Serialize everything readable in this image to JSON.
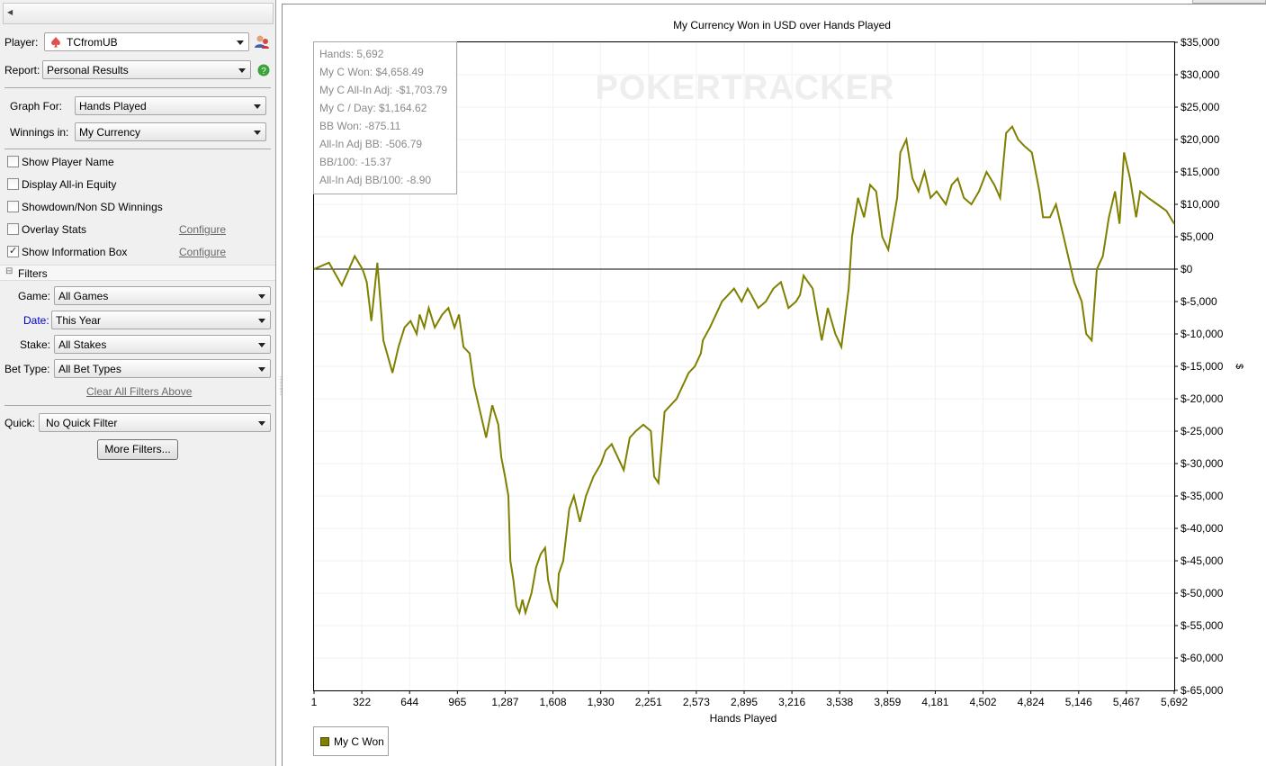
{
  "sidebar": {
    "player_label": "Player:",
    "player_value": "TCfromUB",
    "report_label": "Report:",
    "report_value": "Personal Results",
    "graph_for_label": "Graph For:",
    "graph_for_value": "Hands Played",
    "winnings_label": "Winnings in:",
    "winnings_value": "My Currency",
    "options": [
      {
        "label": "Show Player Name",
        "checked": false
      },
      {
        "label": "Display All-in Equity",
        "checked": false
      },
      {
        "label": "Showdown/Non SD Winnings",
        "checked": false
      },
      {
        "label": "Overlay Stats",
        "checked": false,
        "link": "Configure"
      },
      {
        "label": "Show Information Box",
        "checked": true,
        "link": "Configure"
      }
    ],
    "filters_header": "Filters",
    "game_label": "Game:",
    "game_value": "All Games",
    "date_label": "Date:",
    "date_value": "This Year",
    "stake_label": "Stake:",
    "stake_value": "All Stakes",
    "bet_type_label": "Bet Type:",
    "bet_type_value": "All Bet Types",
    "clear_filters": "Clear All Filters Above",
    "quick_label": "Quick:",
    "quick_value": "No Quick Filter",
    "more_filters": "More Filters..."
  },
  "colors": {
    "line": "#808000",
    "accent_link": "#0000cc",
    "help": "#3aa43a"
  },
  "watermark": "POKERTRACKER",
  "info_box": [
    "Hands: 5,692",
    "My C Won: $4,658.49",
    "My C All-In Adj: -$1,703.79",
    "My C / Day: $1,164.62",
    "BB Won: -875.11",
    "All-In Adj BB: -506.79",
    "BB/100: -15.37",
    "All-In Adj BB/100: -8.90"
  ],
  "chart_data": {
    "type": "line",
    "title": "My Currency Won in USD over Hands Played",
    "xlabel": "Hands Played",
    "ylabel": "$",
    "xlim": [
      1,
      5692
    ],
    "ylim": [
      -65000,
      35000
    ],
    "x_ticks": [
      "1",
      "322",
      "644",
      "965",
      "1,287",
      "1,608",
      "1,930",
      "2,251",
      "2,573",
      "2,895",
      "3,216",
      "3,538",
      "3,859",
      "4,181",
      "4,502",
      "4,824",
      "5,146",
      "5,467",
      "5,692"
    ],
    "y_ticks": [
      "$35,000",
      "$30,000",
      "$25,000",
      "$20,000",
      "$15,000",
      "$10,000",
      "$5,000",
      "$0",
      "$-5,000",
      "$-10,000",
      "$-15,000",
      "$-20,000",
      "$-25,000",
      "$-30,000",
      "$-35,000",
      "$-40,000",
      "$-45,000",
      "$-50,000",
      "$-55,000",
      "$-60,000",
      "$-65,000"
    ],
    "legend": "bottom-left",
    "series": [
      {
        "name": "My C Won",
        "x": [
          1,
          100,
          185,
          270,
          322,
          350,
          380,
          420,
          460,
          520,
          560,
          600,
          640,
          680,
          700,
          730,
          760,
          800,
          850,
          890,
          930,
          960,
          990,
          1030,
          1060,
          1100,
          1140,
          1180,
          1220,
          1240,
          1265,
          1287,
          1300,
          1320,
          1340,
          1360,
          1380,
          1400,
          1440,
          1470,
          1500,
          1530,
          1550,
          1580,
          1608,
          1620,
          1650,
          1690,
          1720,
          1760,
          1800,
          1850,
          1900,
          1930,
          1970,
          2010,
          2050,
          2090,
          2130,
          2180,
          2230,
          2251,
          2280,
          2320,
          2360,
          2400,
          2440,
          2480,
          2520,
          2560,
          2573,
          2620,
          2660,
          2700,
          2740,
          2780,
          2830,
          2870,
          2895,
          2940,
          2990,
          3040,
          3090,
          3140,
          3190,
          3216,
          3240,
          3270,
          3300,
          3330,
          3360,
          3400,
          3450,
          3490,
          3538,
          3560,
          3600,
          3640,
          3680,
          3720,
          3760,
          3800,
          3859,
          3880,
          3920,
          3960,
          4000,
          4040,
          4080,
          4120,
          4181,
          4220,
          4260,
          4300,
          4350,
          4400,
          4450,
          4502,
          4540,
          4580,
          4620,
          4660,
          4700,
          4750,
          4800,
          4824,
          4870,
          4910,
          4950,
          4990,
          5030,
          5080,
          5110,
          5146,
          5180,
          5220,
          5260,
          5300,
          5330,
          5360,
          5400,
          5440,
          5467,
          5520,
          5580,
          5640,
          5692
        ],
        "values": [
          0,
          1000,
          -2500,
          2000,
          0,
          -2000,
          -8000,
          1000,
          -11000,
          -16000,
          -12000,
          -9000,
          -8000,
          -10000,
          -7000,
          -9000,
          -6000,
          -9000,
          -7000,
          -6000,
          -9000,
          -7000,
          -12000,
          -13000,
          -18000,
          -22000,
          -26000,
          -21000,
          -24000,
          -29000,
          -32000,
          -35000,
          -45000,
          -48000,
          -52000,
          -53000,
          -51000,
          -53000,
          -50000,
          -46000,
          -44000,
          -43000,
          -48000,
          -51000,
          -52000,
          -47000,
          -45000,
          -37000,
          -35000,
          -39000,
          -35000,
          -32000,
          -30000,
          -28000,
          -27000,
          -29000,
          -31000,
          -26000,
          -25000,
          -24000,
          -25000,
          -32000,
          -33000,
          -22000,
          -21000,
          -20000,
          -18000,
          -16000,
          -15000,
          -13000,
          -11000,
          -9000,
          -7000,
          -5000,
          -4000,
          -3000,
          -5000,
          -3000,
          -4000,
          -6000,
          -5000,
          -3000,
          -2000,
          -6000,
          -5000,
          -4000,
          -1000,
          -2000,
          -3000,
          -7000,
          -11000,
          -6000,
          -10000,
          -12000,
          -3000,
          5000,
          11000,
          8000,
          13000,
          12000,
          5000,
          3000,
          11000,
          18000,
          20000,
          14000,
          12000,
          15000,
          11000,
          12000,
          10000,
          13000,
          14000,
          11000,
          10000,
          12000,
          15000,
          13000,
          11000,
          21000,
          22000,
          20000,
          19000,
          18000,
          12000,
          8000,
          8000,
          10000,
          6000,
          2000,
          -2000,
          -5000,
          -10000,
          -11000,
          0,
          2000,
          8000,
          12000,
          7000,
          18000,
          14000,
          8000,
          12000,
          11000,
          10000,
          9000,
          7000
        ]
      }
    ]
  }
}
